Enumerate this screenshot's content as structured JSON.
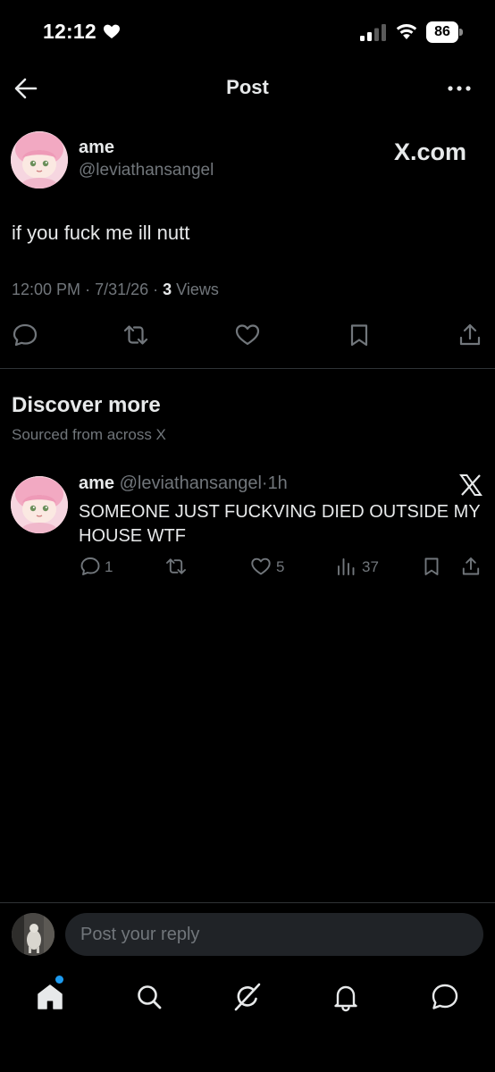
{
  "status_bar": {
    "time": "12:12",
    "battery": "86"
  },
  "nav": {
    "title": "Post"
  },
  "post": {
    "author_name": "ame",
    "author_handle": "@leviathansangel",
    "source_badge": "X.com",
    "text": "if you fuck me ill nutt",
    "time": "12:00 PM",
    "date": "7/31/26",
    "views_count": "3",
    "views_label": "Views"
  },
  "discover": {
    "title": "Discover more",
    "subtitle": "Sourced from across X"
  },
  "related_post": {
    "author_name": "ame",
    "author_handle": "@leviathansangel",
    "age": "1h",
    "text": "SOMEONE JUST FUCKVING DIED OUTSIDE MY HOUSE WTF",
    "replies": "1",
    "reposts": "",
    "likes": "5",
    "views": "37"
  },
  "reply_bar": {
    "placeholder": "Post your reply"
  },
  "tabbar": {
    "tabs": [
      "home-icon",
      "search-icon",
      "grok-icon",
      "notifications-icon",
      "messages-icon"
    ]
  },
  "colors": {
    "background": "#000000",
    "text_primary": "#e7e9ea",
    "text_secondary": "#71767b",
    "divider": "#2f3336",
    "accent_blue": "#1d9bf0",
    "input_bg": "#202327"
  }
}
